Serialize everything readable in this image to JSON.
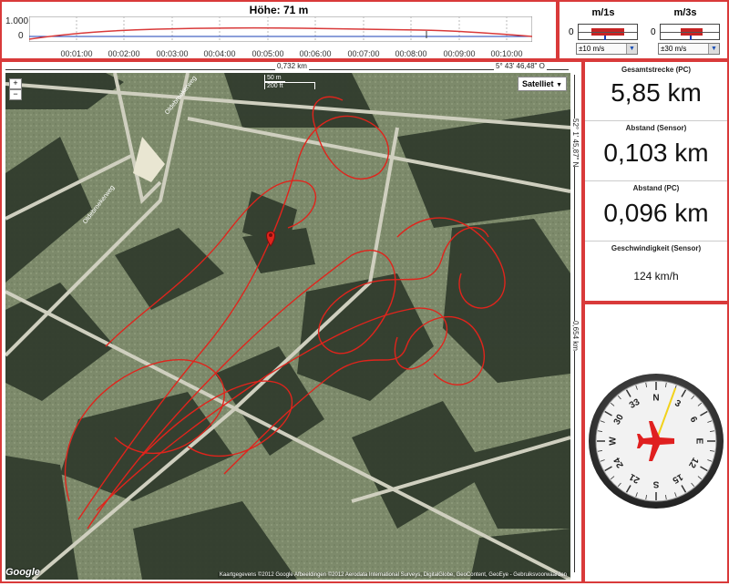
{
  "altitude": {
    "title": "Höhe: 71 m",
    "y_top": "1.000",
    "y_zero": "0",
    "time_ticks": [
      "00:01:00",
      "00:02:00",
      "00:03:00",
      "00:04:00",
      "00:05:00",
      "00:06:00",
      "00:07:00",
      "00:08:00",
      "00:09:00",
      "00:10:00"
    ]
  },
  "vario": {
    "m1": {
      "title": "m/1s",
      "zero": "0",
      "range": "±10 m/s"
    },
    "m3": {
      "title": "m/3s",
      "zero": "0",
      "range": "±30 m/s"
    }
  },
  "map": {
    "top_width_label": "0,732 km",
    "top_coord_label": "5° 43' 46,48\" O",
    "right_coord_label": "52° 1' 45,87\" N",
    "right_height_label": "0,654 km",
    "scale_m": "50 m",
    "scale_ft": "200 ft",
    "map_type": "Satelliet",
    "zoom_in": "+",
    "zoom_out": "−",
    "logo": "Google",
    "attribution": "Kaartgegevens ©2012 Google Afbeeldingen ©2012 Aerodata International Surveys, DigitalGlobe, GeoContent, GeoEye - Gebruiksvoorwaarden",
    "road_label_1": "Oldebroekerweg",
    "road_label_2": "Oldebroekerweg"
  },
  "stats": {
    "total_label": "Gesamtstrecke (PC)",
    "total_value": "5,85 km",
    "dist_sensor_label": "Abstand (Sensor)",
    "dist_sensor_value": "0,103 km",
    "dist_pc_label": "Abstand (PC)",
    "dist_pc_value": "0,096 km",
    "speed_label": "Geschwindigkeit (Sensor)",
    "speed_value": "124 km/h"
  },
  "compass": {
    "heading_deg": 20,
    "labels": [
      "N",
      "3",
      "6",
      "E",
      "12",
      "15",
      "S",
      "21",
      "24",
      "W",
      "30",
      "33"
    ]
  },
  "colors": {
    "accent": "#d93a3a",
    "track": "#e0241c",
    "plane": "#e02020"
  }
}
